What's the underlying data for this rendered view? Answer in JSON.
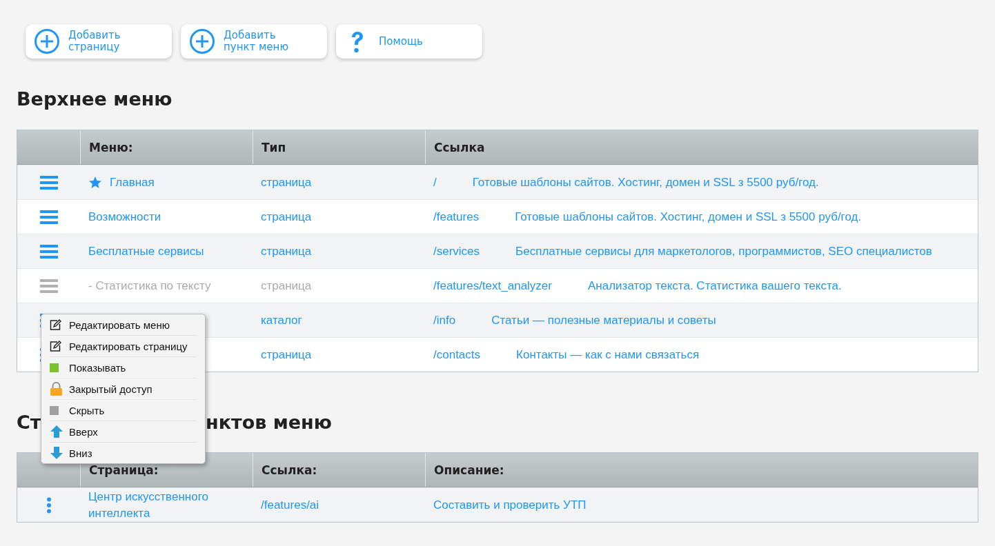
{
  "toolbar": [
    {
      "kind": "add",
      "label": "Добавить\nстраницу"
    },
    {
      "kind": "add",
      "label": "Добавить\nпункт меню"
    },
    {
      "kind": "help",
      "label": "Помощь"
    }
  ],
  "top_menu": {
    "title": "Верхнее меню",
    "columns": [
      "Меню:",
      "Тип",
      "Ссылка"
    ],
    "rows": [
      {
        "name": "Главная",
        "home": true,
        "visible": true,
        "type": "страница",
        "link": "/",
        "description": "Готовые шаблоны сайтов. Хостинг, домен и SSL з 5500 руб/год."
      },
      {
        "name": "Возможности",
        "home": false,
        "visible": true,
        "type": "страница",
        "link": "/features",
        "description": "Готовые шаблоны сайтов. Хостинг, домен и SSL з 5500 руб/год."
      },
      {
        "name": "Бесплатные сервисы",
        "home": false,
        "visible": true,
        "type": "страница",
        "link": "/services",
        "description": "Бесплатные сервисы для маркетологов, программистов, SEO специалистов"
      },
      {
        "name": " - Статистика по тексту",
        "home": false,
        "visible": false,
        "type": "страница",
        "link": "/features/text_analyzer",
        "description": "Анализатор текста. Статистика вашего текста."
      },
      {
        "home": false,
        "visible": true,
        "type": "каталог",
        "link": "/info",
        "description": "Статьи — полезные материалы и советы"
      },
      {
        "home": false,
        "visible": true,
        "type": "страница",
        "link": "/contacts",
        "description": "Контакты — как с нами связаться"
      }
    ]
  },
  "pages_section": {
    "title_parts": [
      "Ст",
      "нктов меню"
    ],
    "columns": [
      "Страница:",
      "Ссылка:",
      "Описание:"
    ],
    "rows": [
      {
        "page": "Центр искусственного\nинтеллекта",
        "link": "/features/ai",
        "description": "Составить и проверить УТП"
      }
    ]
  },
  "context_menu": [
    {
      "kind": "edit",
      "label": "Редактировать меню"
    },
    {
      "kind": "edit",
      "label": "Редактировать страницу"
    },
    {
      "kind": "show",
      "label": "Показывать"
    },
    {
      "kind": "lock",
      "label": "Закрытый доступ"
    },
    {
      "kind": "hide",
      "label": "Скрыть"
    },
    {
      "kind": "up",
      "label": "Вверх"
    },
    {
      "kind": "down",
      "label": "Вниз"
    }
  ]
}
